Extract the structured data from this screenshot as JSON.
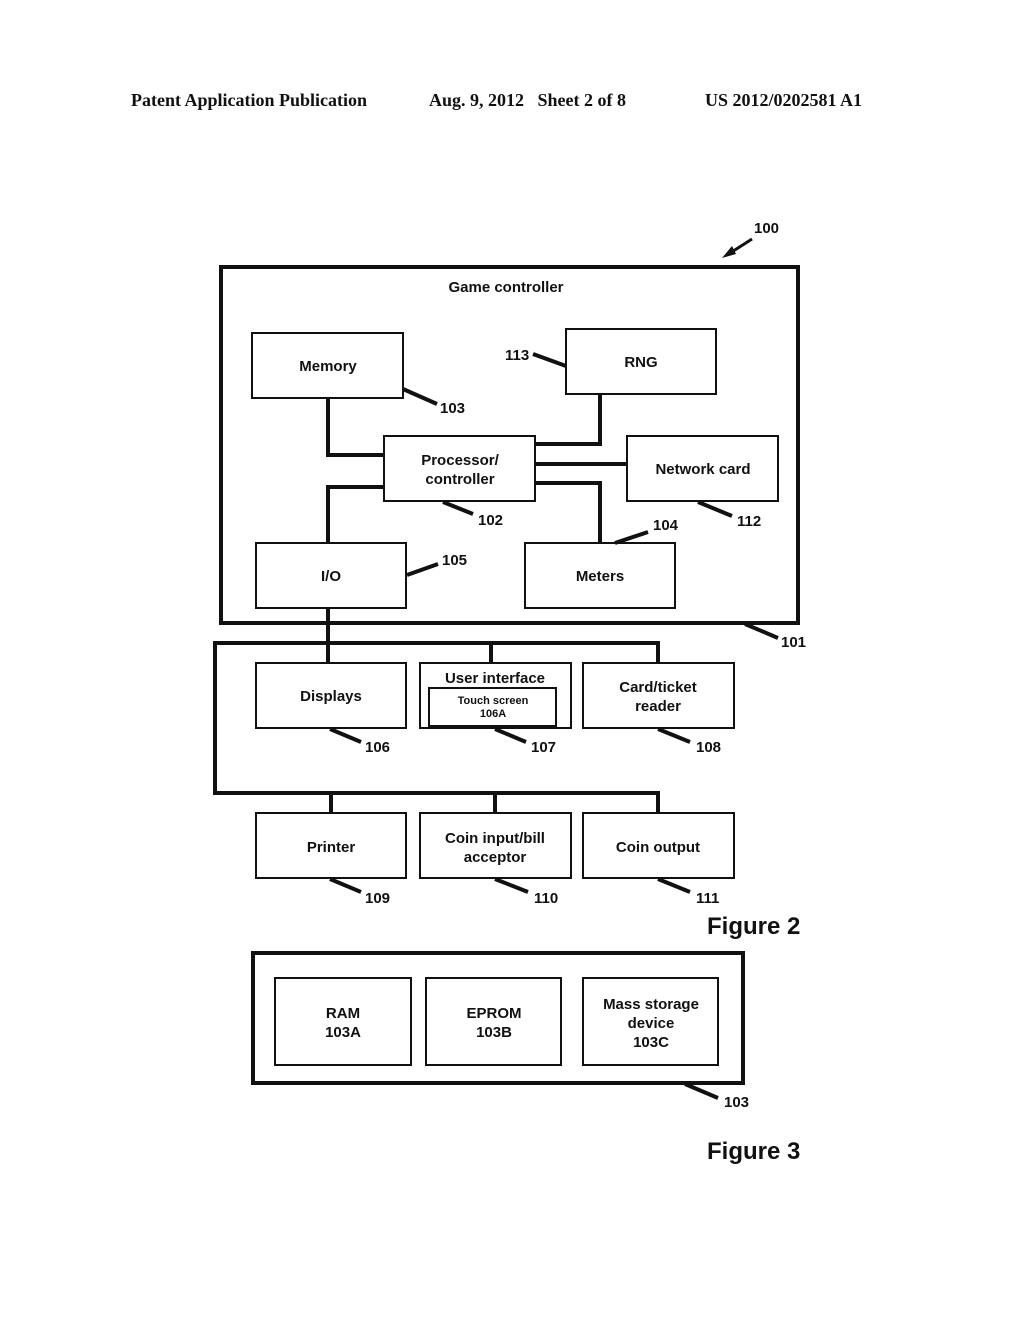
{
  "header": {
    "publication": "Patent Application Publication",
    "date_sheet": "Aug. 9, 2012   Sheet 2 of 8",
    "number": "US 2012/0202581 A1"
  },
  "figure2": {
    "caption": "Figure 2",
    "system_ref": "100",
    "game_controller": {
      "title": "Game controller",
      "ref": "101"
    },
    "components": {
      "memory": {
        "label": "Memory",
        "ref": "103"
      },
      "rng": {
        "label": "RNG",
        "ref": "113"
      },
      "processor": {
        "line1": "Processor/",
        "line2": "controller",
        "ref": "102"
      },
      "network_card": {
        "label": "Network card",
        "ref": "112"
      },
      "io": {
        "label": "I/O",
        "ref": "105"
      },
      "meters": {
        "label": "Meters",
        "ref": "104"
      },
      "displays": {
        "label": "Displays",
        "ref": "106"
      },
      "user_interface": {
        "label": "User interface",
        "inner_line1": "Touch screen",
        "inner_line2": "106A",
        "ref": "107"
      },
      "card_reader": {
        "line1": "Card/ticket",
        "line2": "reader",
        "ref": "108"
      },
      "printer": {
        "label": "Printer",
        "ref": "109"
      },
      "coin_input": {
        "line1": "Coin input/bill",
        "line2": "acceptor",
        "ref": "110"
      },
      "coin_output": {
        "label": "Coin output",
        "ref": "111"
      }
    }
  },
  "figure3": {
    "caption": "Figure 3",
    "ref": "103",
    "ram": {
      "line1": "RAM",
      "line2": "103A"
    },
    "eprom": {
      "line1": "EPROM",
      "line2": "103B"
    },
    "mass_storage": {
      "line1": "Mass storage",
      "line2": "device",
      "line3": "103C"
    }
  }
}
